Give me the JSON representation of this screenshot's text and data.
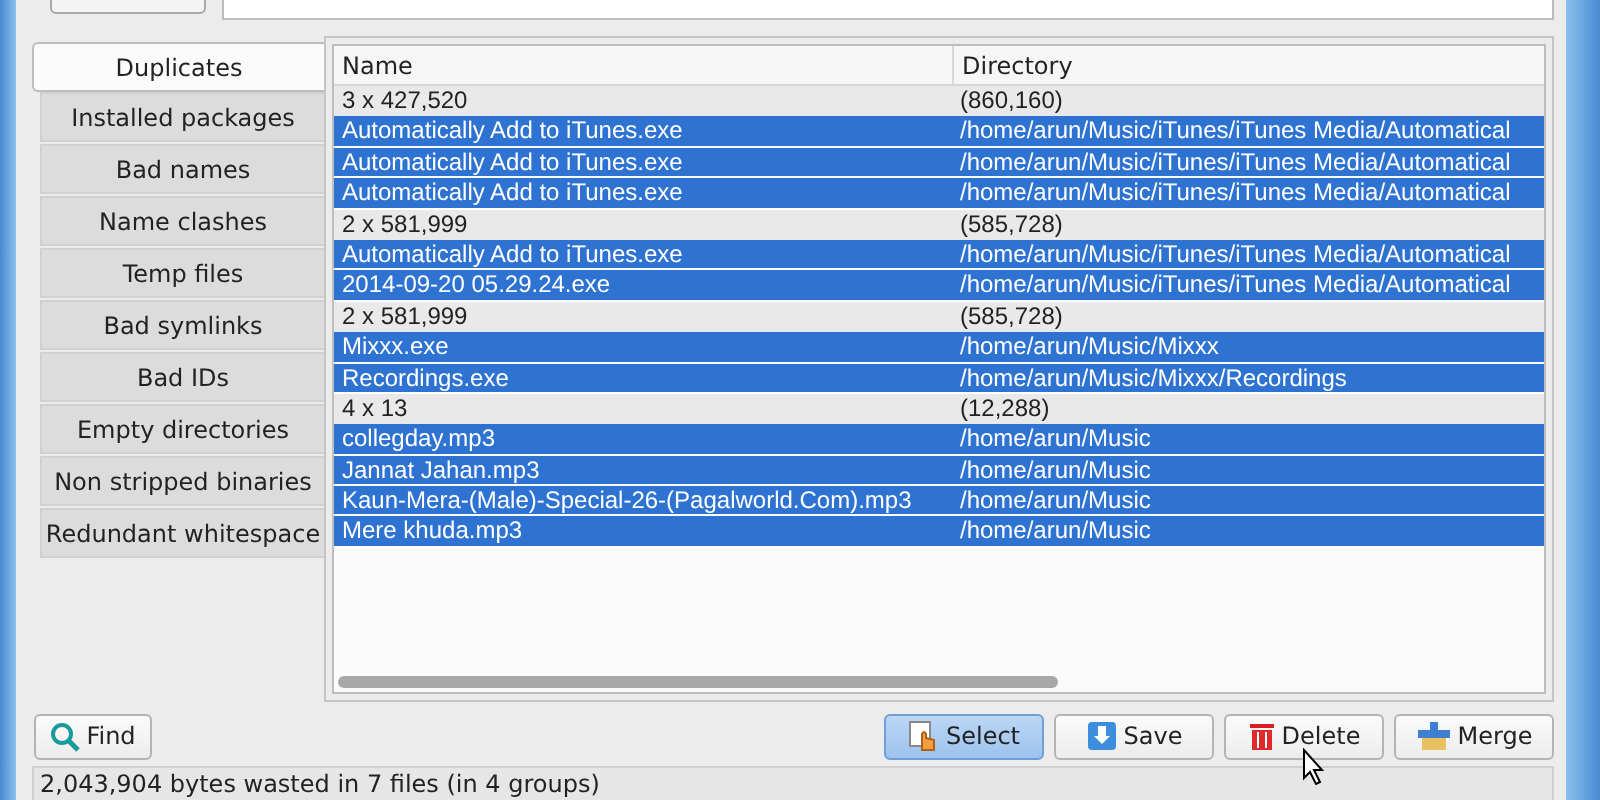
{
  "tabs": [
    {
      "label": "Duplicates",
      "selected": true
    },
    {
      "label": "Installed packages",
      "selected": false
    },
    {
      "label": "Bad names",
      "selected": false
    },
    {
      "label": "Name clashes",
      "selected": false
    },
    {
      "label": "Temp files",
      "selected": false
    },
    {
      "label": "Bad symlinks",
      "selected": false
    },
    {
      "label": "Bad IDs",
      "selected": false
    },
    {
      "label": "Empty directories",
      "selected": false
    },
    {
      "label": "Non stripped binaries",
      "selected": false
    },
    {
      "label": "Redundant whitespace",
      "selected": false
    }
  ],
  "table": {
    "columns": [
      "Name",
      "Directory"
    ],
    "rows": [
      {
        "selected": false,
        "cells": [
          "3 x 427,520",
          "(860,160)"
        ]
      },
      {
        "selected": true,
        "cells": [
          "Automatically Add to iTunes.exe",
          "/home/arun/Music/iTunes/iTunes Media/Automatical"
        ]
      },
      {
        "selected": true,
        "cells": [
          "Automatically Add to iTunes.exe",
          "/home/arun/Music/iTunes/iTunes Media/Automatical"
        ]
      },
      {
        "selected": true,
        "cells": [
          "Automatically Add to iTunes.exe",
          "/home/arun/Music/iTunes/iTunes Media/Automatical"
        ]
      },
      {
        "selected": false,
        "cells": [
          "2 x 581,999",
          "(585,728)"
        ]
      },
      {
        "selected": true,
        "cells": [
          "Automatically Add to iTunes.exe",
          "/home/arun/Music/iTunes/iTunes Media/Automatical"
        ]
      },
      {
        "selected": true,
        "cells": [
          "2014-09-20 05.29.24.exe",
          "/home/arun/Music/iTunes/iTunes Media/Automatical"
        ]
      },
      {
        "selected": false,
        "cells": [
          "2 x 581,999",
          "(585,728)"
        ]
      },
      {
        "selected": true,
        "cells": [
          "Mixxx.exe",
          "/home/arun/Music/Mixxx"
        ]
      },
      {
        "selected": true,
        "cells": [
          "Recordings.exe",
          "/home/arun/Music/Mixxx/Recordings"
        ]
      },
      {
        "selected": false,
        "cells": [
          "4 x 13",
          "(12,288)"
        ]
      },
      {
        "selected": true,
        "cells": [
          "collegday.mp3",
          "/home/arun/Music"
        ]
      },
      {
        "selected": true,
        "cells": [
          "Jannat Jahan.mp3",
          "/home/arun/Music"
        ]
      },
      {
        "selected": true,
        "cells": [
          "Kaun-Mera-(Male)-Special-26-(Pagalworld.Com).mp3",
          "/home/arun/Music"
        ]
      },
      {
        "selected": true,
        "cells": [
          "Mere khuda.mp3",
          "/home/arun/Music"
        ]
      }
    ]
  },
  "find_button": {
    "label": "Find"
  },
  "actions": [
    {
      "kind": "select",
      "label": "Select",
      "default": true
    },
    {
      "kind": "save",
      "label": "Save",
      "default": false
    },
    {
      "kind": "delete",
      "label": "Delete",
      "default": false
    },
    {
      "kind": "merge",
      "label": "Merge",
      "default": false
    }
  ],
  "status_bar": "2,043,904 bytes wasted in 7 files (in 4 groups)"
}
